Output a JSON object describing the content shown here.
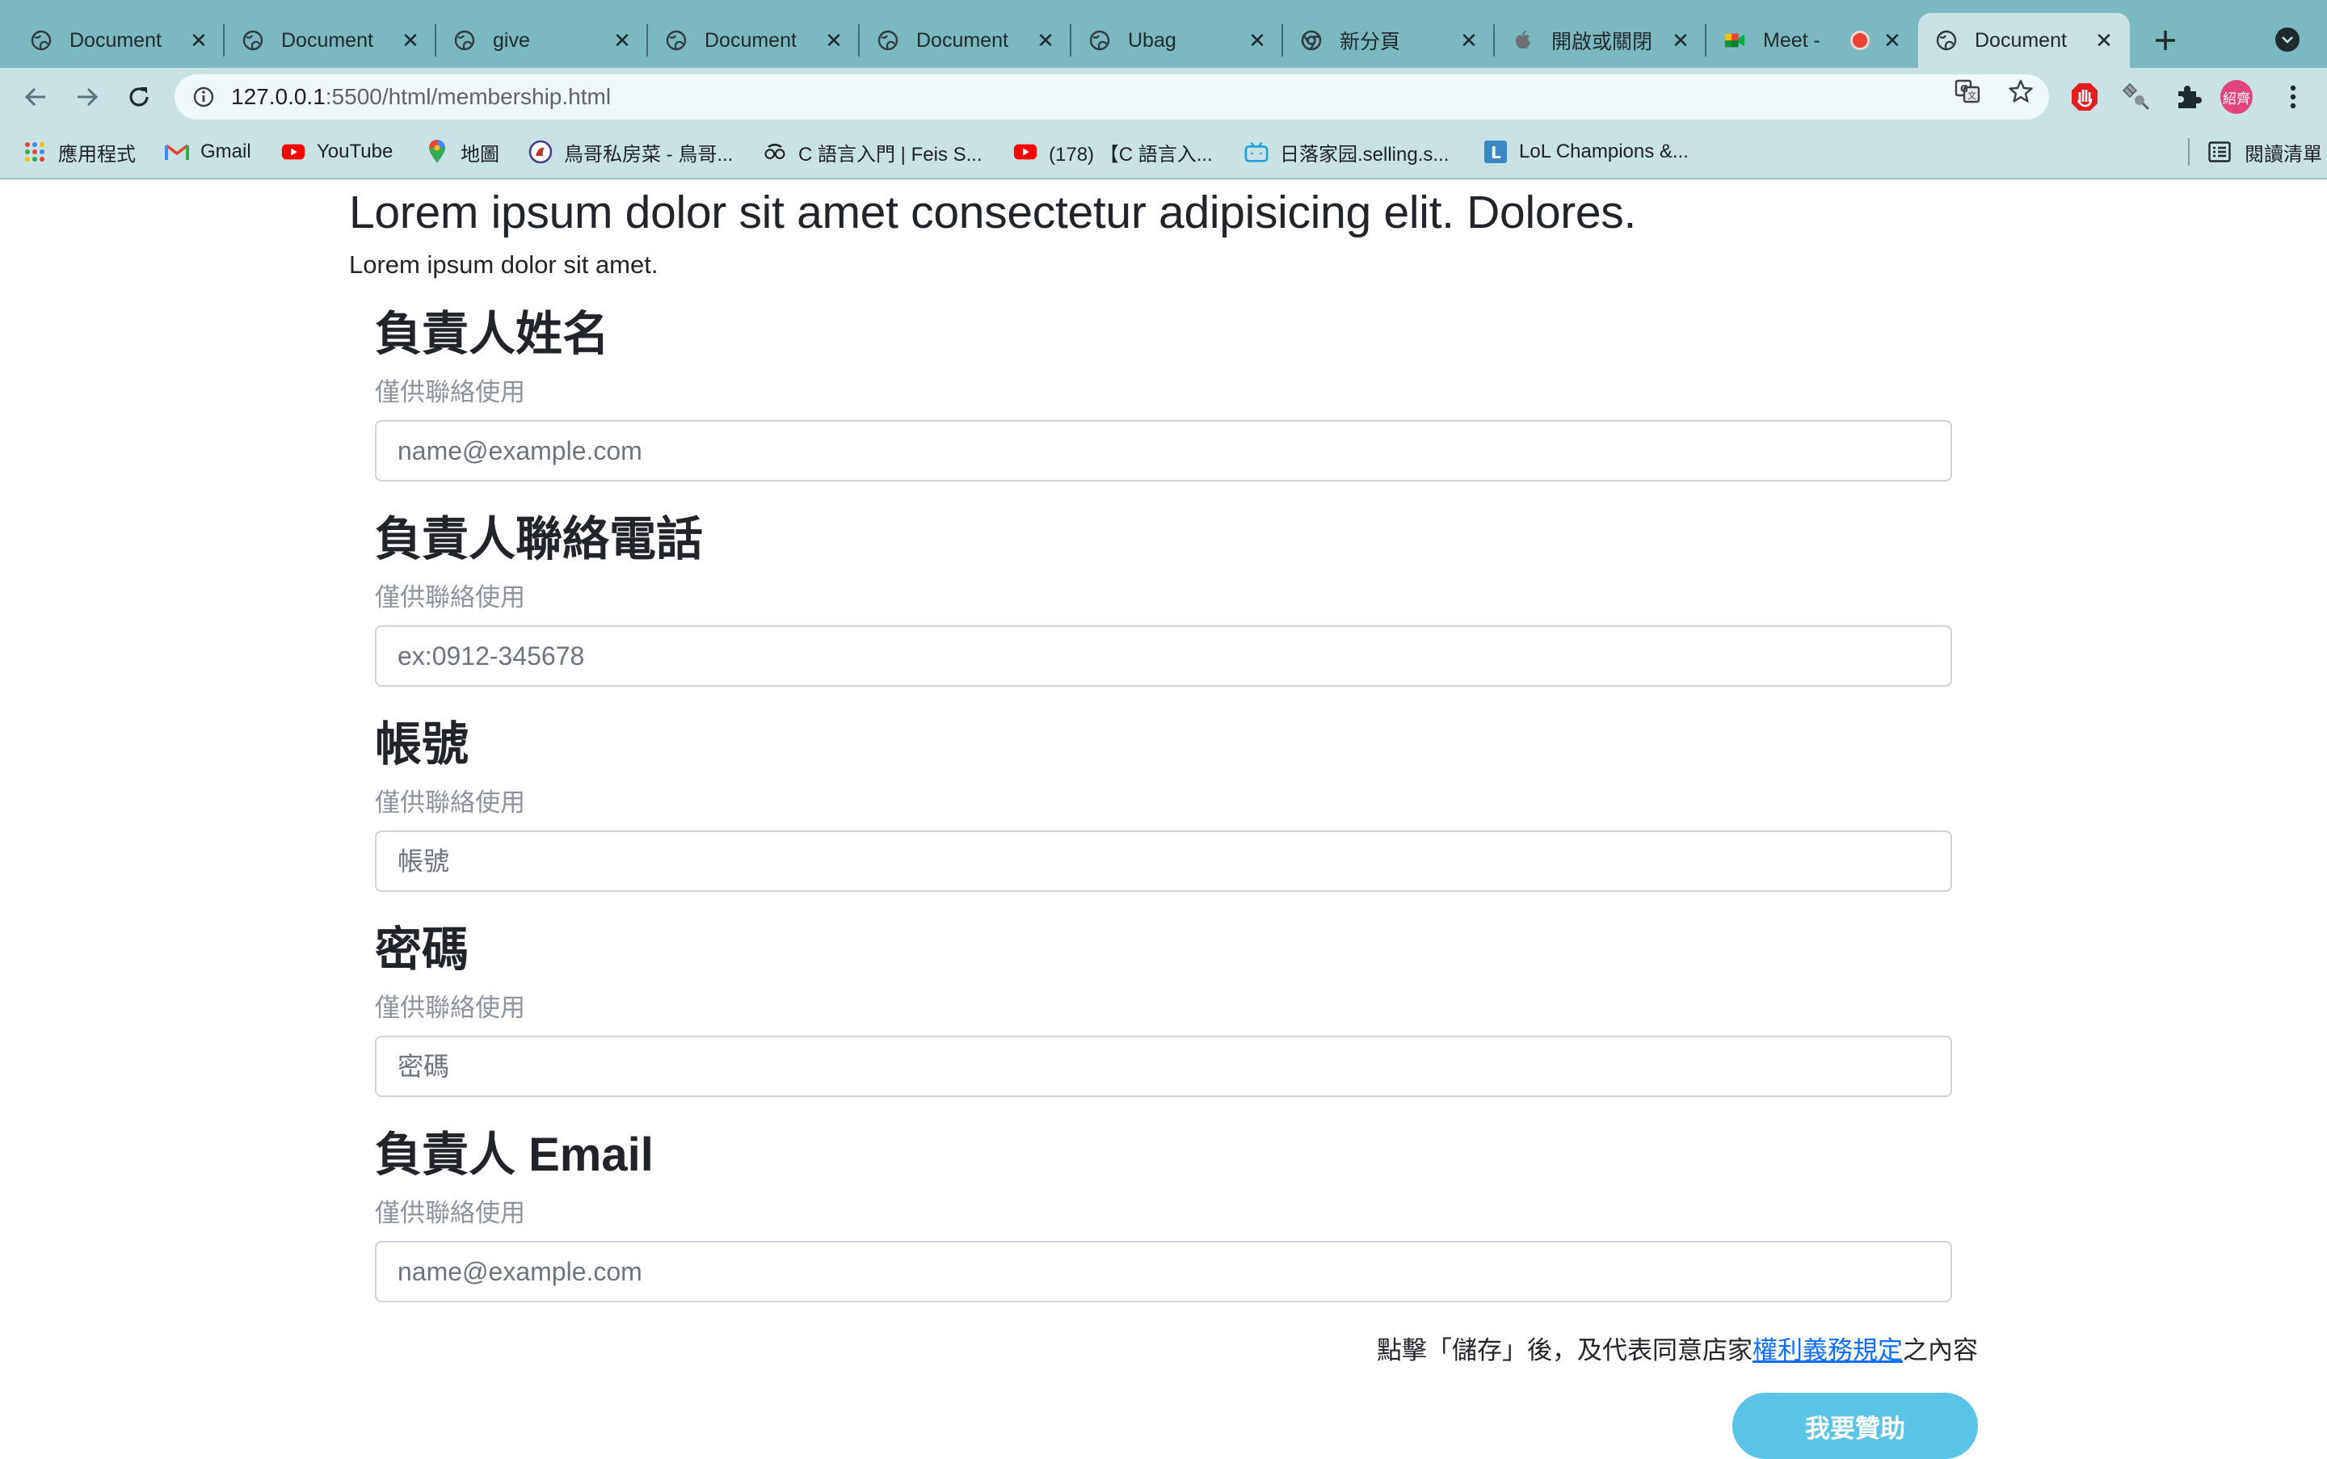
{
  "browser": {
    "tabs": [
      {
        "title": "Document",
        "favicon": "globe-icon"
      },
      {
        "title": "Document",
        "favicon": "globe-icon"
      },
      {
        "title": "give",
        "favicon": "globe-icon"
      },
      {
        "title": "Document",
        "favicon": "globe-icon"
      },
      {
        "title": "Document",
        "favicon": "globe-icon"
      },
      {
        "title": "Ubag",
        "favicon": "globe-icon"
      },
      {
        "title": "新分頁",
        "favicon": "chrome-icon"
      },
      {
        "title": "開啟或關閉",
        "favicon": "apple-icon"
      },
      {
        "title": "Meet - ",
        "favicon": "meet-icon"
      },
      {
        "title": "Document",
        "favicon": "globe-icon",
        "active": true
      }
    ],
    "url_host": "127.0.0.1",
    "url_rest": ":5500/html/membership.html",
    "bookmarks": [
      {
        "label": "應用程式",
        "icon": "apps-grid-icon"
      },
      {
        "label": "Gmail",
        "icon": "gmail-icon"
      },
      {
        "label": "YouTube",
        "icon": "youtube-icon"
      },
      {
        "label": "地圖",
        "icon": "maps-pin-icon"
      },
      {
        "label": "鳥哥私房菜 - 鳥哥...",
        "icon": "bird-logo-icon"
      },
      {
        "label": "C 語言入門 | Feis S...",
        "icon": "glasses-icon"
      },
      {
        "label": "(178) 【C 語言入...",
        "icon": "youtube-icon"
      },
      {
        "label": "日落家园.selling.s...",
        "icon": "tv-icon"
      },
      {
        "label": "LoL Champions &...",
        "icon": "letter-l-icon"
      }
    ],
    "reading_list": "閱讀清單",
    "profile_label": "紹齊"
  },
  "page": {
    "heading": "Lorem ipsum dolor sit amet consectetur adipisicing elit. Dolores.",
    "lead": "Lorem ipsum dolor sit amet.",
    "fields": [
      {
        "label": "負責人姓名",
        "help": "僅供聯絡使用",
        "placeholder": "name@example.com"
      },
      {
        "label": "負責人聯絡電話",
        "help": "僅供聯絡使用",
        "placeholder": "ex:0912-345678"
      },
      {
        "label": "帳號",
        "help": "僅供聯絡使用",
        "placeholder": "帳號"
      },
      {
        "label": "密碼",
        "help": "僅供聯絡使用",
        "placeholder": "密碼"
      },
      {
        "label": "負責人 Email",
        "help": "僅供聯絡使用",
        "placeholder": "name@example.com"
      }
    ],
    "agree_prefix": "點擊「儲存」後，及代表同意店家",
    "agree_link": "權利義務規定",
    "agree_suffix": "之內容",
    "submit_label": "我要贊助"
  },
  "colors": {
    "tabstrip": "#7cb8bf",
    "toolbar": "#c9e3e5",
    "submit": "#5bc4e6",
    "link": "#0d6efd"
  }
}
